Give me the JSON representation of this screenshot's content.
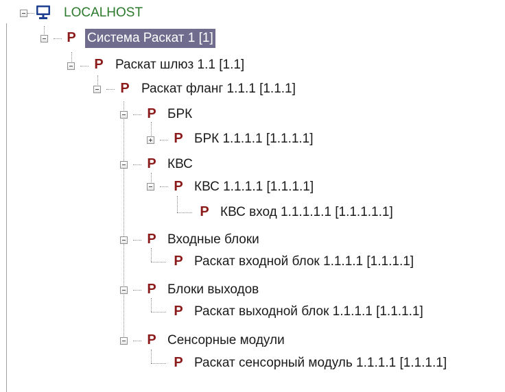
{
  "tree": {
    "root": {
      "label": "LOCALHOST",
      "icon": "computer-icon",
      "color": "#2b7a2b"
    },
    "nodes": [
      {
        "label": "Система Раскат 1 [1]",
        "selected": true,
        "expander": "expanded"
      },
      {
        "label": "Раскат шлюз 1.1 [1.1]",
        "expander": "expanded"
      },
      {
        "label": "Раскат фланг 1.1.1 [1.1.1]",
        "expander": "expanded"
      },
      {
        "label": "БРК",
        "expander": "expanded"
      },
      {
        "label": "БРК 1.1.1.1 [1.1.1.1]",
        "expander": "collapsed"
      },
      {
        "label": "КВС",
        "expander": "expanded"
      },
      {
        "label": "КВС 1.1.1.1 [1.1.1.1]",
        "expander": "expanded"
      },
      {
        "label": "КВС вход 1.1.1.1.1 [1.1.1.1.1]",
        "expander": "none"
      },
      {
        "label": "Входные блоки",
        "expander": "expanded"
      },
      {
        "label": "Раскат входной блок 1.1.1.1 [1.1.1.1]",
        "expander": "none"
      },
      {
        "label": "Блоки выходов",
        "expander": "expanded"
      },
      {
        "label": "Раскат выходной блок 1.1.1.1 [1.1.1.1]",
        "expander": "none"
      },
      {
        "label": "Сенсорные модули",
        "expander": "expanded"
      },
      {
        "label": "Раскат сенсорный модуль 1.1.1.1 [1.1.1.1]",
        "expander": "none"
      }
    ],
    "node_icon": {
      "glyph": "P",
      "name": "raskat-device-icon",
      "color": "#8b1a1a"
    },
    "selection_color": "#6f6c8e"
  }
}
